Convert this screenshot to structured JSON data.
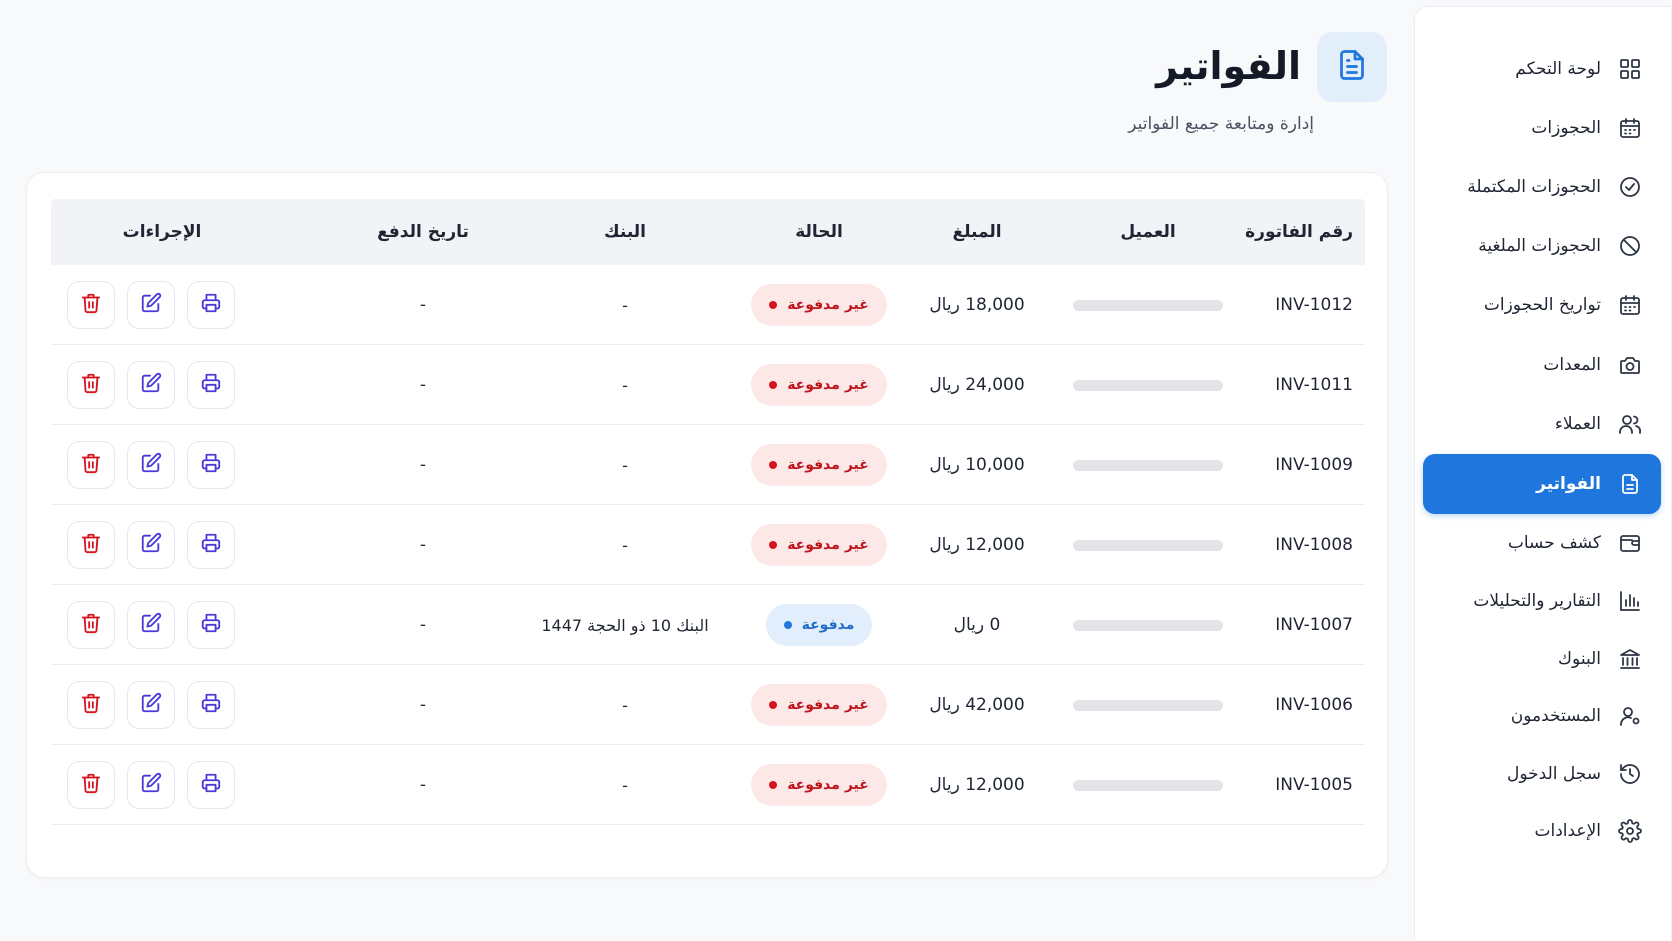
{
  "sidebar": {
    "items": [
      {
        "label": "لوحة التحكم",
        "icon": "dashboard-grid-icon"
      },
      {
        "label": "الحجوزات",
        "icon": "calendar-icon"
      },
      {
        "label": "الحجوزات المكتملة",
        "icon": "check-circle-icon"
      },
      {
        "label": "الحجوزات الملغية",
        "icon": "ban-icon"
      },
      {
        "label": "تواريخ الحجوزات",
        "icon": "calendar-icon"
      },
      {
        "label": "المعدات",
        "icon": "camera-icon"
      },
      {
        "label": "العملاء",
        "icon": "users-icon"
      },
      {
        "label": "الفواتير",
        "icon": "file-text-icon",
        "active": true
      },
      {
        "label": "كشف حساب",
        "icon": "wallet-icon"
      },
      {
        "label": "التقارير والتحليلات",
        "icon": "bar-chart-icon"
      },
      {
        "label": "البنوك",
        "icon": "bank-icon"
      },
      {
        "label": "المستخدمون",
        "icon": "user-settings-icon"
      },
      {
        "label": "سجل الدخول",
        "icon": "history-icon"
      },
      {
        "label": "الإعدادات",
        "icon": "gear-icon"
      }
    ],
    "active_color": "#1f76dc"
  },
  "header": {
    "title": "الفواتير",
    "subtitle": "إدارة ومتابعة جميع الفواتير",
    "icon": "file-text-icon"
  },
  "table": {
    "columns": {
      "invoice": "رقم الفاتورة",
      "customer": "العميل",
      "amount": "المبلغ",
      "status": "الحالة",
      "bank": "البنك",
      "payment_date": "تاريخ الدفع",
      "actions": "الإجراءات"
    },
    "rows": [
      {
        "invoice": "INV-1012",
        "amount": "18,000 ريال",
        "status": "غير مدفوعة",
        "status_type": "unpaid",
        "bank": "-",
        "payment_date": "-"
      },
      {
        "invoice": "INV-1011",
        "amount": "24,000 ريال",
        "status": "غير مدفوعة",
        "status_type": "unpaid",
        "bank": "-",
        "payment_date": "-"
      },
      {
        "invoice": "INV-1009",
        "amount": "10,000 ريال",
        "status": "غير مدفوعة",
        "status_type": "unpaid",
        "bank": "-",
        "payment_date": "-"
      },
      {
        "invoice": "INV-1008",
        "amount": "12,000 ريال",
        "status": "غير مدفوعة",
        "status_type": "unpaid",
        "bank": "-",
        "payment_date": "-"
      },
      {
        "invoice": "INV-1007",
        "amount": "0 ريال",
        "status": "مدفوعة",
        "status_type": "paid",
        "bank": "البنك 10 ذو الحجة 1447",
        "payment_date": "-"
      },
      {
        "invoice": "INV-1006",
        "amount": "42,000 ريال",
        "status": "غير مدفوعة",
        "status_type": "unpaid",
        "bank": "-",
        "payment_date": "-"
      },
      {
        "invoice": "INV-1005",
        "amount": "12,000 ريال",
        "status": "غير مدفوعة",
        "status_type": "unpaid",
        "bank": "-",
        "payment_date": "-"
      }
    ],
    "action_icons": [
      "printer-icon",
      "edit-icon",
      "trash-icon"
    ],
    "colors": {
      "unpaid": "#d4141b",
      "paid": "#1f76dc",
      "action": "#4b3ad8"
    }
  }
}
